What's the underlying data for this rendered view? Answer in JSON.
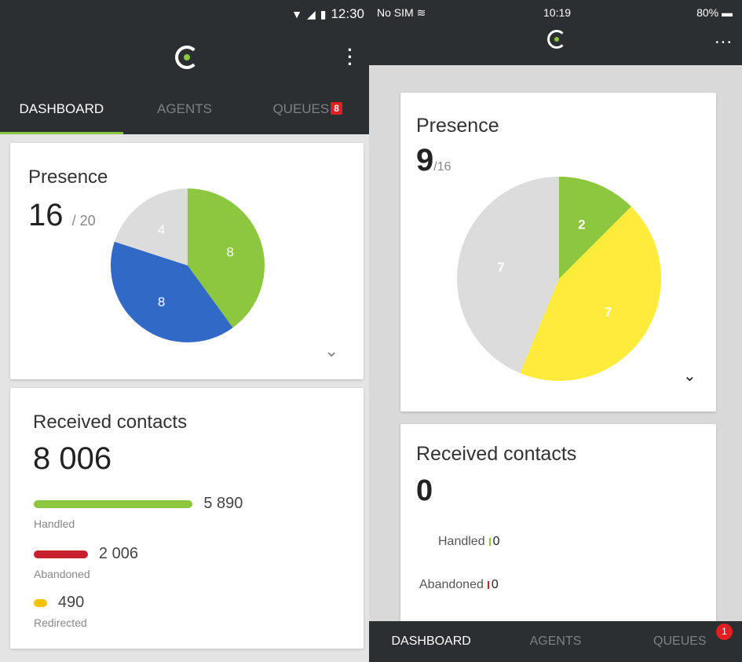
{
  "android": {
    "status": {
      "time": "12:30"
    },
    "tabs": [
      {
        "label": "DASHBOARD"
      },
      {
        "label": "AGENTS"
      },
      {
        "label": "QUEUES",
        "badge": "8"
      }
    ],
    "presence": {
      "title": "Presence",
      "value": "16",
      "total": "/ 20",
      "slices": [
        {
          "label": "8",
          "value": 8,
          "color": "#8dc63f"
        },
        {
          "label": "8",
          "value": 8,
          "color": "#3069c6"
        },
        {
          "label": "4",
          "value": 4,
          "color": "#dcdcdc"
        }
      ]
    },
    "contacts": {
      "title": "Received contacts",
      "value": "8 006",
      "rows": [
        {
          "label": "Handled",
          "value": "5 890",
          "color": "#8dc63f",
          "fraction": 0.7357
        },
        {
          "label": "Abandoned",
          "value": "2 006",
          "color": "#c8202d",
          "fraction": 0.2506
        },
        {
          "label": "Redirected",
          "value": "490",
          "color": "#f5c400",
          "fraction": 0.0612
        }
      ]
    }
  },
  "ios": {
    "status": {
      "carrier": "No SIM",
      "time": "10:19",
      "battery": "80%"
    },
    "more": "...",
    "presence": {
      "title": "Presence",
      "value": "9",
      "total": "/16",
      "slices": [
        {
          "label": "2",
          "value": 2,
          "color": "#8dc63f"
        },
        {
          "label": "7",
          "value": 7,
          "color": "#ffeb3b"
        },
        {
          "label": "7",
          "value": 7,
          "color": "#dcdcdc"
        }
      ]
    },
    "contacts": {
      "title": "Received contacts",
      "value": "0",
      "rows": [
        {
          "label": "Handled",
          "value": "0",
          "color": "#8dc63f"
        },
        {
          "label": "Abandoned",
          "value": "0",
          "color": "#c8202d"
        }
      ]
    },
    "tabs": [
      {
        "label": "DASHBOARD"
      },
      {
        "label": "AGENTS"
      },
      {
        "label": "QUEUES",
        "badge": "1"
      }
    ]
  }
}
